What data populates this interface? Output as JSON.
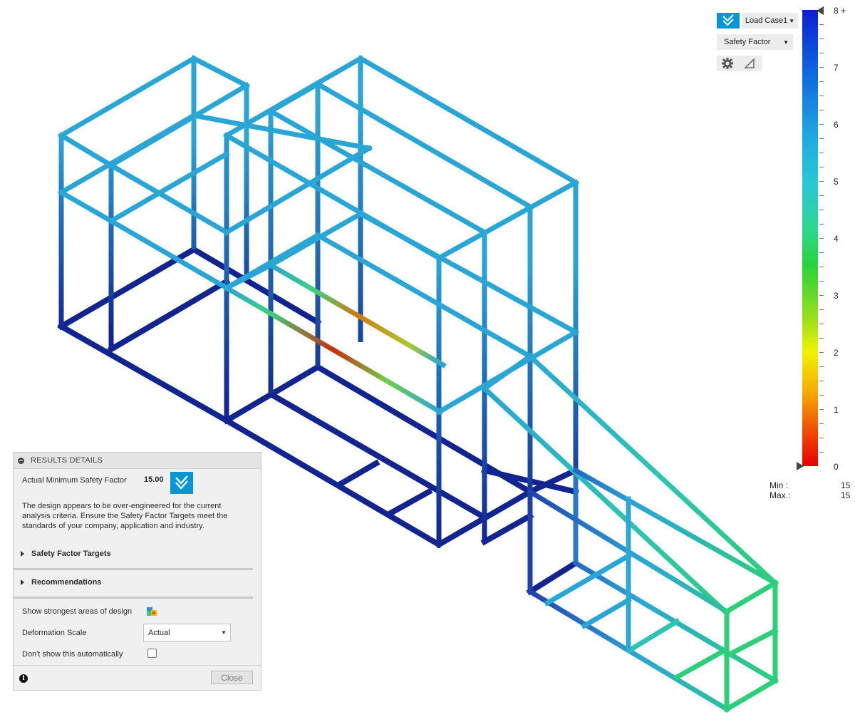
{
  "toolbar": {
    "load_case": "Load Case1",
    "result_type": "Safety Factor"
  },
  "legend": {
    "labels": [
      "8 +",
      "7",
      "6",
      "5",
      "4",
      "3",
      "2",
      "1",
      "0"
    ],
    "min_label": "Min :",
    "min_value": "15",
    "max_label": "Max.:",
    "max_value": "15",
    "colors": [
      "#0a1fd0",
      "#1eaae0",
      "#2bd88f",
      "#9be01a",
      "#f2f200",
      "#f5a800",
      "#e60000"
    ]
  },
  "results_panel": {
    "title": "RESULTS DETAILS",
    "min_sf_label": "Actual Minimum Safety Factor",
    "min_sf_value": "15.00",
    "message": "The design appears to be over-engineered for the current analysis criteria. Ensure the Safety Factor Targets meet the standards of your company, application and industry.",
    "sections": [
      "Safety Factor Targets",
      "Recommendations"
    ],
    "show_strongest_label": "Show strongest areas of design",
    "deformation_label": "Deformation Scale",
    "deformation_value": "Actual",
    "dont_show_label": "Don't show this automatically",
    "close_label": "Close"
  }
}
